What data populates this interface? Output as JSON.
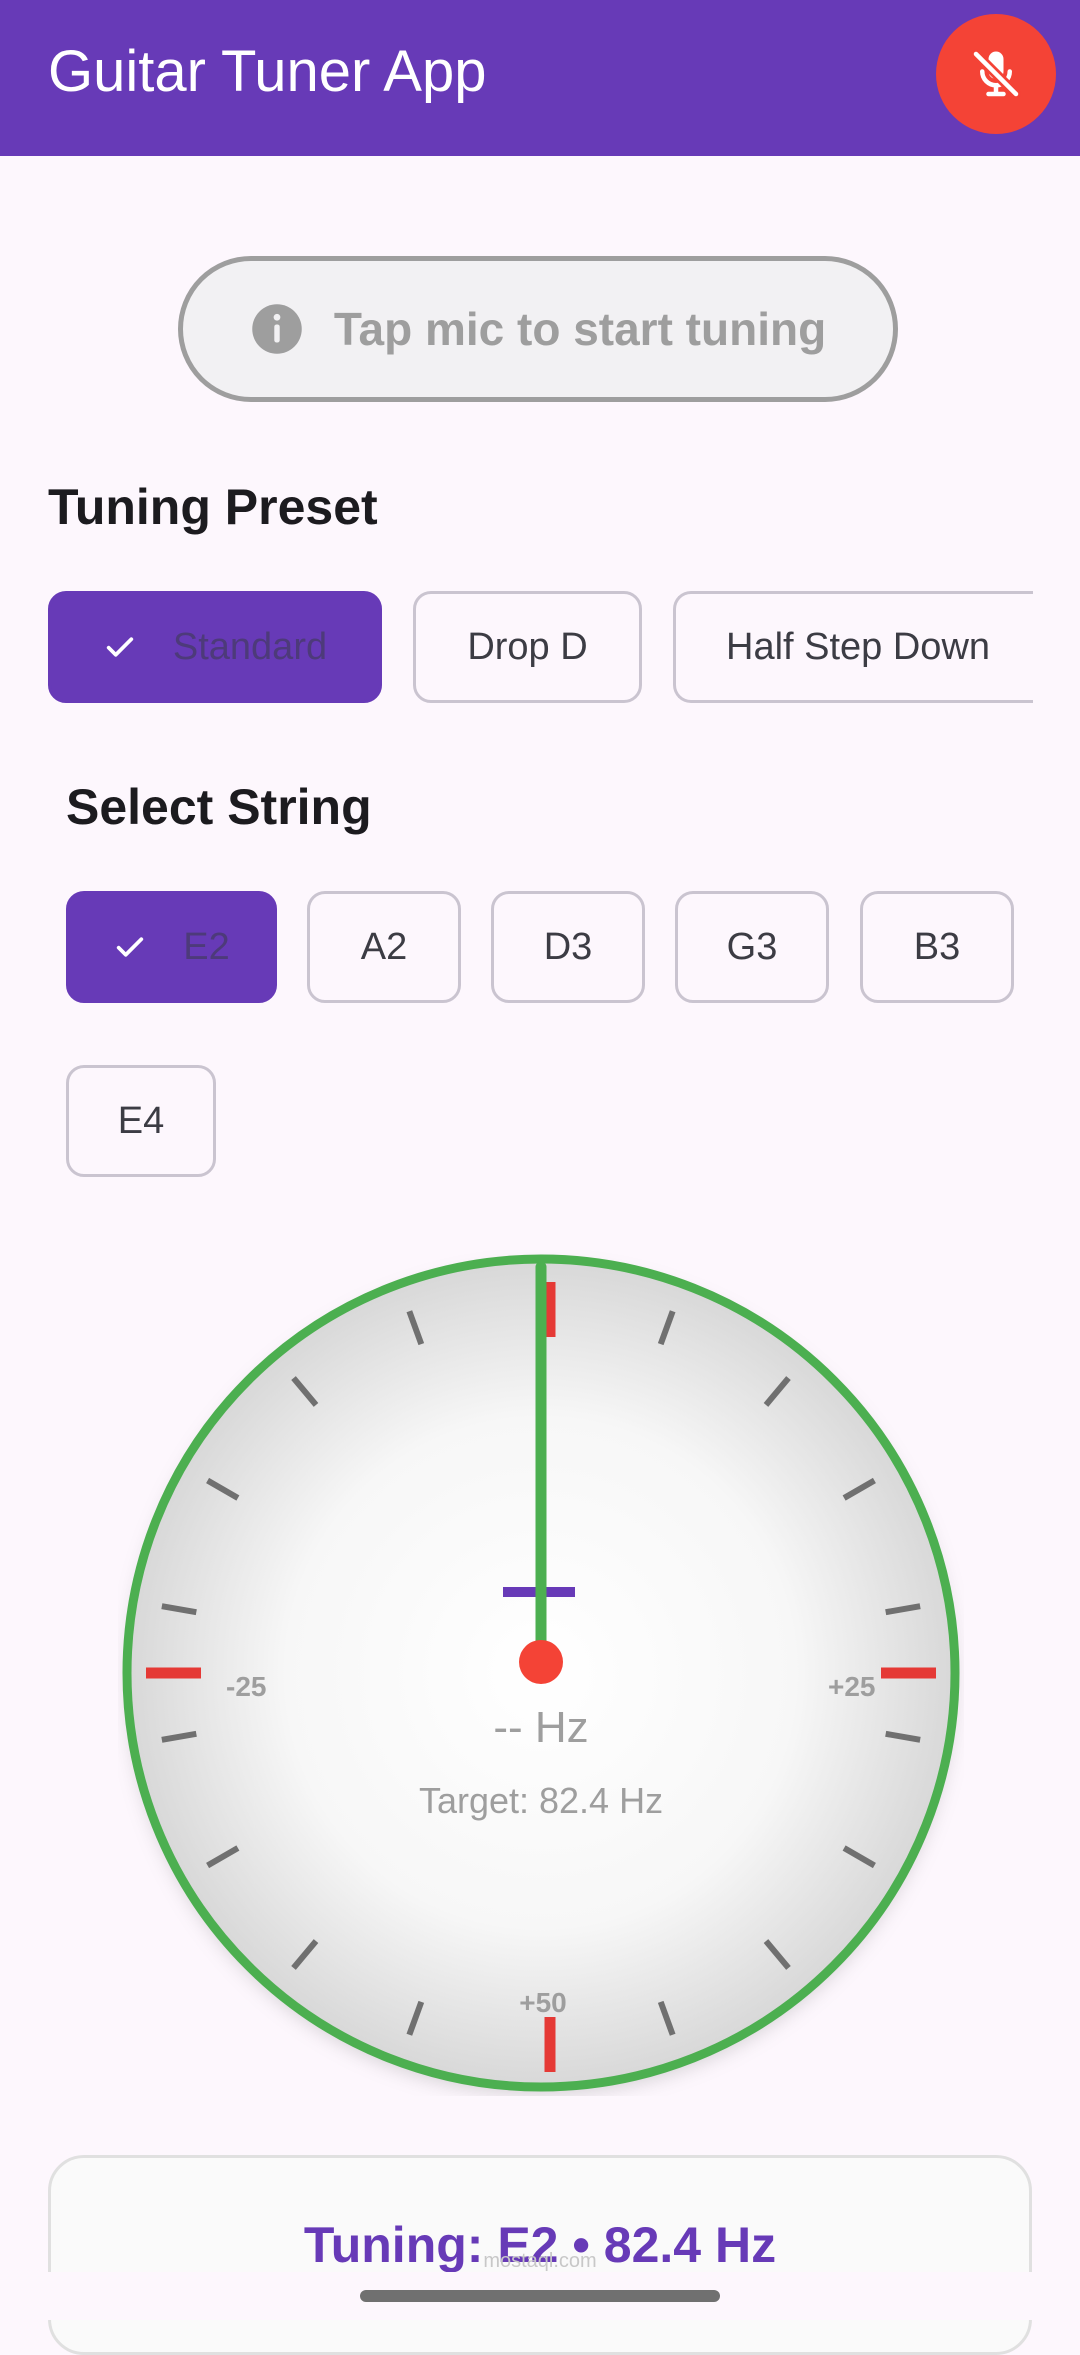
{
  "app": {
    "title": "Guitar Tuner App"
  },
  "mic": {
    "icon": "mic-off-icon",
    "color": "#f44336"
  },
  "status": {
    "text": "Tap mic to start tuning",
    "icon": "info-icon"
  },
  "presets": {
    "title": "Tuning Preset",
    "items": [
      {
        "label": "Standard",
        "selected": true
      },
      {
        "label": "Drop D",
        "selected": false
      },
      {
        "label": "Half Step Down",
        "selected": false
      }
    ]
  },
  "strings": {
    "title": "Select String",
    "items": [
      {
        "label": "E2",
        "selected": true
      },
      {
        "label": "A2",
        "selected": false
      },
      {
        "label": "D3",
        "selected": false
      },
      {
        "label": "G3",
        "selected": false
      },
      {
        "label": "B3",
        "selected": false
      },
      {
        "label": "E4",
        "selected": false
      }
    ]
  },
  "gauge": {
    "left_label": "-25",
    "right_label": "+25",
    "bottom_label": "+50",
    "frequency": "-- Hz",
    "target": "Target: 82.4 Hz",
    "needle_cents": 0,
    "ring_color": "#4caf50",
    "marker_color": "#e53935",
    "center_color": "#f44336",
    "in_tune_mark_color": "#673ab7"
  },
  "summary": {
    "tuning": "Tuning: E2 • 82.4 Hz"
  },
  "watermark": "mostaql.com",
  "colors": {
    "primary": "#673ab7",
    "background": "#fdf7fd"
  }
}
